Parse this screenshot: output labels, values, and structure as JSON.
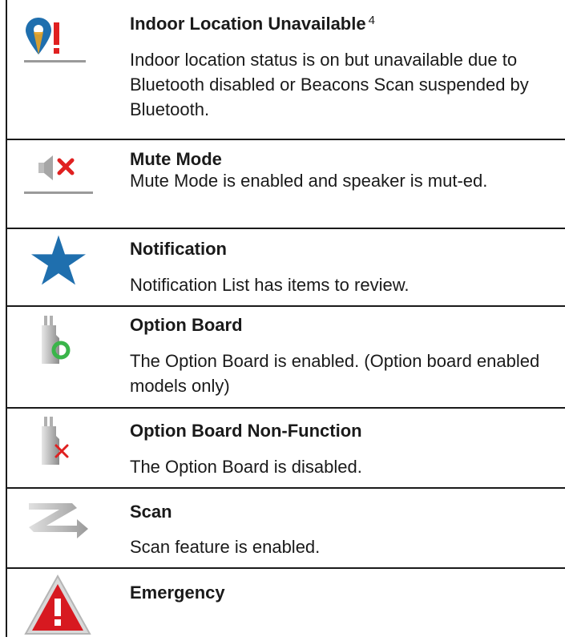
{
  "entries": [
    {
      "icon": "indoor-location-unavailable-icon",
      "title": "Indoor Location Unavailable",
      "sup": "4",
      "description": "Indoor location status is on but unavailable due to Bluetooth disabled or Beacons Scan suspended by Bluetooth."
    },
    {
      "icon": "mute-mode-icon",
      "title": "Mute Mode",
      "description": "Mute Mode is enabled and speaker is mut-ed."
    },
    {
      "icon": "star-notification-icon",
      "title": "Notification",
      "description": "Notification List has items to review."
    },
    {
      "icon": "option-board-icon",
      "title": "Option Board",
      "description": "The Option Board is enabled. (Option board enabled models only)"
    },
    {
      "icon": "option-board-non-function-icon",
      "title": "Option Board Non-Function",
      "description": "The Option Board is disabled."
    },
    {
      "icon": "scan-icon",
      "title": "Scan",
      "description": "Scan feature is enabled."
    },
    {
      "icon": "emergency-warning-icon",
      "title": "Emergency",
      "description": ""
    }
  ],
  "colors": {
    "blue": "#1f6fae",
    "red": "#e02020",
    "green": "#3ab54a",
    "gray": "#9a9a9a",
    "rule": "#1a1a1a"
  }
}
